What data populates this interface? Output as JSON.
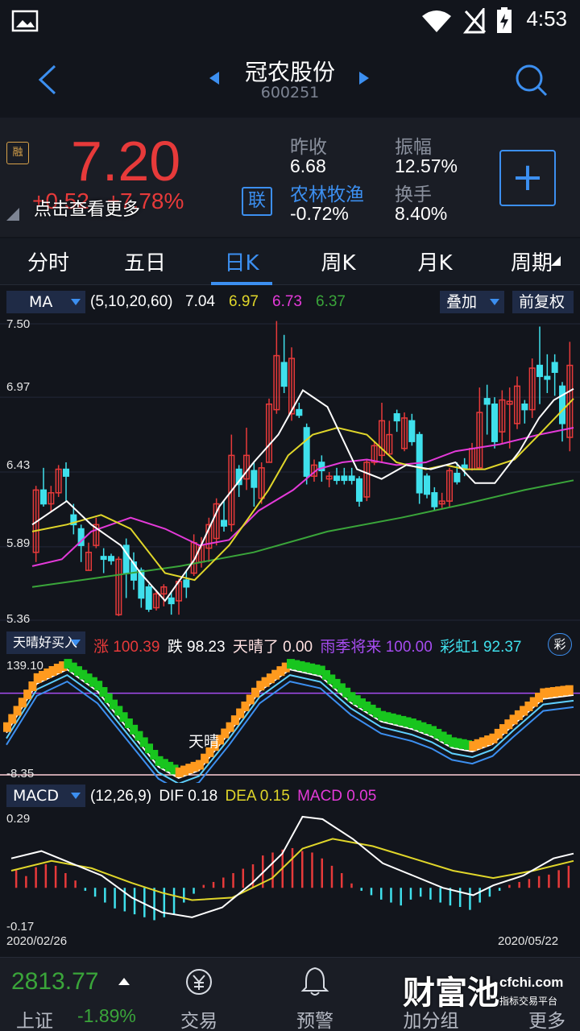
{
  "status_bar": {
    "time": "4:53"
  },
  "header": {
    "title": "冠农股份",
    "code": "600251"
  },
  "quote": {
    "price": "7.20",
    "change": "+0.52",
    "change_pct": "+7.78%",
    "tip": "点击查看更多",
    "badge": "融",
    "prev_close_label": "昨收",
    "prev_close": "6.68",
    "sector_name": "农林牧渔",
    "sector_change": "-0.72%",
    "amplitude_label": "振幅",
    "amplitude": "12.57%",
    "turnover_label": "换手",
    "turnover": "8.40%",
    "link_label": "联",
    "add_label": "+"
  },
  "tabs": [
    "分时",
    "五日",
    "日K",
    "周K",
    "月K",
    "周期"
  ],
  "active_tab": 2,
  "ma_bar": {
    "name": "MA",
    "params": "(5,10,20,60)",
    "ma5": "7.04",
    "ma10": "6.97",
    "ma20": "6.73",
    "ma60": "6.37",
    "overlay_label": "叠加",
    "adjust_label": "前复权"
  },
  "kline_axis": {
    "top": "7.50",
    "upper": "6.97",
    "mid": "6.43",
    "lower": "5.89",
    "bottom": "5.36"
  },
  "signal_bar": {
    "name": "天晴好买入",
    "zhang_label": "涨",
    "zhang_value": "100.39",
    "die_label": "跌",
    "die_value": "98.23",
    "tianqing_label": "天晴了",
    "tianqing_value": "0.00",
    "yuji_label": "雨季将来",
    "yuji_value": "100.00",
    "caihong_label": "彩虹1",
    "caihong_value": "92.37",
    "cai_icon": "彩"
  },
  "signal_axis": {
    "top": "139.10",
    "bottom": "-8.35",
    "annotation": "天晴"
  },
  "macd_bar": {
    "name": "MACD",
    "params": "(12,26,9)",
    "dif_label": "DIF",
    "dif": "0.18",
    "dea_label": "DEA",
    "dea": "0.15",
    "macd_label": "MACD",
    "macd": "0.05"
  },
  "macd_axis": {
    "top": "0.29",
    "bottom": "-0.17",
    "date_start": "2020/02/26",
    "date_end": "2020/05/22"
  },
  "bottom_bar": {
    "index_value": "2813.77",
    "index_name": "上证",
    "index_change": "-1.89%",
    "trade_label": "交易",
    "alert_label": "预警",
    "group_label": "加分组",
    "more_label": "更多",
    "watermark_main": "财富池",
    "watermark_site": "cfchi.com",
    "watermark_sub": "指标交易平台"
  },
  "colors": {
    "up": "#e73a3a",
    "down": "#3fe0ec",
    "accent": "#3c8ff0",
    "ma5": "#ffffff",
    "ma10": "#e0d62a",
    "ma20": "#e43ad9",
    "ma60": "#3aa53a",
    "macd_dea": "#e0d62a"
  },
  "chart_data": {
    "type": "candlestick",
    "ylim": [
      5.36,
      7.5
    ],
    "candles": [
      [
        5.85,
        6.3,
        6.33,
        5.78
      ],
      [
        6.3,
        6.2,
        6.46,
        6.18
      ],
      [
        6.2,
        6.28,
        6.33,
        6.14
      ],
      [
        6.28,
        6.45,
        6.48,
        6.25
      ],
      [
        6.45,
        6.4,
        6.5,
        6.22
      ],
      [
        6.12,
        6.05,
        6.2,
        5.98
      ],
      [
        6.02,
        5.9,
        6.05,
        5.78
      ],
      [
        5.72,
        5.85,
        5.92,
        5.72
      ],
      [
        5.9,
        6.05,
        6.1,
        5.88
      ],
      [
        5.82,
        5.8,
        5.88,
        5.7
      ],
      [
        5.82,
        5.79,
        5.84,
        5.76
      ],
      [
        5.4,
        5.8,
        5.82,
        5.39
      ],
      [
        5.9,
        5.7,
        5.95,
        5.52
      ],
      [
        5.78,
        5.65,
        5.85,
        5.58
      ],
      [
        5.72,
        5.52,
        5.74,
        5.45
      ],
      [
        5.6,
        5.44,
        5.62,
        5.42
      ],
      [
        5.45,
        5.55,
        5.58,
        5.43
      ],
      [
        5.55,
        5.6,
        5.62,
        5.46
      ],
      [
        5.52,
        5.48,
        5.56,
        5.4
      ],
      [
        5.5,
        5.64,
        5.66,
        5.4
      ],
      [
        5.65,
        5.6,
        5.72,
        5.52
      ],
      [
        5.7,
        5.92,
        5.98,
        5.68
      ],
      [
        5.78,
        5.9,
        5.96,
        5.74
      ],
      [
        5.88,
        6.05,
        6.1,
        5.78
      ],
      [
        5.95,
        6.2,
        6.24,
        5.9
      ],
      [
        6.08,
        6.04,
        6.22,
        6.0
      ],
      [
        6.05,
        6.55,
        6.7,
        6.0
      ],
      [
        6.45,
        6.34,
        6.48,
        6.25
      ],
      [
        6.38,
        6.55,
        6.75,
        6.3
      ],
      [
        6.44,
        6.32,
        6.5,
        6.18
      ],
      [
        6.24,
        6.46,
        6.5,
        6.2
      ],
      [
        6.5,
        6.92,
        6.96,
        6.5
      ],
      [
        6.88,
        7.27,
        7.52,
        6.85
      ],
      [
        7.22,
        7.05,
        7.42,
        7.0
      ],
      [
        6.85,
        7.25,
        7.33,
        6.8
      ],
      [
        6.88,
        6.84,
        6.93,
        6.82
      ],
      [
        6.75,
        6.4,
        6.78,
        6.34
      ],
      [
        6.4,
        6.48,
        6.52,
        6.36
      ],
      [
        6.5,
        6.44,
        6.55,
        6.36
      ],
      [
        6.38,
        6.4,
        6.43,
        6.32
      ],
      [
        6.4,
        6.37,
        6.46,
        6.34
      ],
      [
        6.4,
        6.37,
        6.46,
        6.34
      ],
      [
        6.4,
        6.37,
        6.46,
        6.34
      ],
      [
        6.38,
        6.22,
        6.4,
        6.18
      ],
      [
        6.25,
        6.5,
        6.52,
        6.22
      ],
      [
        6.5,
        6.62,
        6.65,
        6.48
      ],
      [
        6.55,
        6.8,
        6.93,
        6.5
      ],
      [
        6.56,
        6.7,
        6.8,
        6.56
      ],
      [
        6.85,
        6.8,
        6.88,
        6.72
      ],
      [
        6.6,
        6.82,
        6.86,
        6.58
      ],
      [
        6.8,
        6.65,
        6.85,
        6.62
      ],
      [
        6.7,
        6.28,
        6.72,
        6.2
      ],
      [
        6.4,
        6.27,
        6.42,
        6.24
      ],
      [
        6.28,
        6.18,
        6.32,
        6.15
      ],
      [
        6.2,
        6.22,
        6.28,
        6.17
      ],
      [
        6.22,
        6.44,
        6.46,
        6.18
      ],
      [
        6.42,
        6.36,
        6.5,
        6.34
      ],
      [
        6.48,
        6.45,
        6.53,
        6.4
      ],
      [
        6.45,
        6.6,
        6.64,
        6.44
      ],
      [
        6.46,
        6.86,
        7.04,
        6.46
      ],
      [
        6.96,
        6.92,
        7.06,
        6.7
      ],
      [
        6.92,
        6.65,
        6.97,
        6.6
      ],
      [
        6.72,
        6.95,
        7.02,
        6.64
      ],
      [
        6.92,
        6.94,
        7.04,
        6.6
      ],
      [
        6.78,
        7.05,
        7.12,
        6.74
      ],
      [
        6.92,
        6.88,
        6.95,
        6.78
      ],
      [
        6.88,
        7.18,
        7.25,
        6.82
      ],
      [
        7.2,
        7.12,
        7.48,
        6.92
      ],
      [
        7.12,
        7.1,
        7.28,
        7.0
      ],
      [
        7.22,
        7.15,
        7.28,
        6.98
      ],
      [
        7.05,
        6.78,
        7.08,
        6.65
      ],
      [
        6.68,
        7.2,
        7.37,
        6.58
      ]
    ],
    "ma5_points": [
      [
        0,
        6.05
      ],
      [
        7,
        6.22
      ],
      [
        12,
        6.05
      ],
      [
        18,
        5.9
      ],
      [
        22,
        5.7
      ],
      [
        27,
        5.5
      ],
      [
        33,
        5.8
      ],
      [
        38,
        6.18
      ],
      [
        45,
        6.5
      ],
      [
        50,
        6.7
      ],
      [
        55,
        7.02
      ],
      [
        60,
        6.9
      ],
      [
        66,
        6.45
      ],
      [
        71,
        6.38
      ],
      [
        76,
        6.48
      ],
      [
        81,
        6.45
      ],
      [
        86,
        6.5
      ],
      [
        90,
        6.35
      ],
      [
        94,
        6.35
      ],
      [
        99,
        6.58
      ],
      [
        103,
        6.82
      ],
      [
        106,
        6.95
      ],
      [
        110,
        7.03
      ]
    ],
    "ma10_points": [
      [
        0,
        6.0
      ],
      [
        7,
        6.05
      ],
      [
        14,
        6.12
      ],
      [
        20,
        6.02
      ],
      [
        27,
        5.7
      ],
      [
        33,
        5.65
      ],
      [
        40,
        5.9
      ],
      [
        48,
        6.3
      ],
      [
        52,
        6.55
      ],
      [
        57,
        6.7
      ],
      [
        62,
        6.75
      ],
      [
        68,
        6.7
      ],
      [
        74,
        6.5
      ],
      [
        80,
        6.45
      ],
      [
        84,
        6.48
      ],
      [
        88,
        6.45
      ],
      [
        92,
        6.45
      ],
      [
        98,
        6.52
      ],
      [
        103,
        6.7
      ],
      [
        110,
        6.96
      ]
    ],
    "ma20_points": [
      [
        0,
        5.75
      ],
      [
        6,
        5.8
      ],
      [
        12,
        6.0
      ],
      [
        20,
        6.1
      ],
      [
        27,
        6.02
      ],
      [
        34,
        5.9
      ],
      [
        40,
        5.94
      ],
      [
        46,
        6.15
      ],
      [
        53,
        6.3
      ],
      [
        58,
        6.45
      ],
      [
        63,
        6.5
      ],
      [
        68,
        6.52
      ],
      [
        74,
        6.48
      ],
      [
        80,
        6.5
      ],
      [
        86,
        6.58
      ],
      [
        95,
        6.63
      ],
      [
        103,
        6.7
      ],
      [
        110,
        6.75
      ]
    ],
    "ma60_points": [
      [
        0,
        5.6
      ],
      [
        14,
        5.67
      ],
      [
        30,
        5.75
      ],
      [
        45,
        5.85
      ],
      [
        60,
        6.0
      ],
      [
        75,
        6.1
      ],
      [
        88,
        6.2
      ],
      [
        100,
        6.3
      ],
      [
        110,
        6.37
      ]
    ],
    "macd_bars": [
      0.12,
      0.08,
      0.14,
      0.16,
      0.15,
      0.1,
      0.05,
      -0.02,
      -0.06,
      -0.1,
      -0.14,
      -0.16,
      -0.18,
      -0.2,
      -0.22,
      -0.2,
      -0.18,
      -0.1,
      -0.04,
      0.02,
      0.04,
      0.07,
      0.1,
      0.13,
      0.16,
      0.22,
      0.24,
      0.26,
      0.27,
      0.25,
      0.24,
      0.2,
      0.15,
      0.1,
      0.03,
      -0.02,
      -0.05,
      -0.08,
      -0.1,
      -0.12,
      -0.08,
      -0.06,
      -0.08,
      -0.1,
      -0.12,
      -0.13,
      -0.15,
      -0.1,
      -0.06,
      -0.02,
      0.02,
      0.04,
      0.06,
      0.08,
      0.09,
      0.12,
      0.15
    ],
    "dif_points": [
      [
        0,
        0.12
      ],
      [
        6,
        0.15
      ],
      [
        12,
        0.1
      ],
      [
        18,
        0.05
      ],
      [
        24,
        -0.04
      ],
      [
        30,
        -0.1
      ],
      [
        36,
        -0.12
      ],
      [
        42,
        -0.08
      ],
      [
        48,
        0.02
      ],
      [
        54,
        0.14
      ],
      [
        58,
        0.29
      ],
      [
        62,
        0.28
      ],
      [
        68,
        0.2
      ],
      [
        74,
        0.1
      ],
      [
        80,
        0.05
      ],
      [
        86,
        0.0
      ],
      [
        92,
        -0.03
      ],
      [
        96,
        0.01
      ],
      [
        102,
        0.05
      ],
      [
        108,
        0.12
      ],
      [
        112,
        0.14
      ]
    ],
    "dea_points": [
      [
        0,
        0.07
      ],
      [
        8,
        0.11
      ],
      [
        16,
        0.08
      ],
      [
        24,
        0.02
      ],
      [
        30,
        -0.02
      ],
      [
        36,
        -0.05
      ],
      [
        44,
        -0.04
      ],
      [
        52,
        0.04
      ],
      [
        58,
        0.16
      ],
      [
        64,
        0.2
      ],
      [
        72,
        0.17
      ],
      [
        80,
        0.12
      ],
      [
        88,
        0.07
      ],
      [
        96,
        0.04
      ],
      [
        104,
        0.07
      ],
      [
        112,
        0.11
      ]
    ],
    "signal_series": [
      [
        0,
        55
      ],
      [
        6,
        120
      ],
      [
        12,
        139
      ],
      [
        18,
        110
      ],
      [
        24,
        60
      ],
      [
        30,
        10
      ],
      [
        34,
        -5
      ],
      [
        38,
        5
      ],
      [
        44,
        55
      ],
      [
        50,
        110
      ],
      [
        56,
        139
      ],
      [
        62,
        130
      ],
      [
        68,
        95
      ],
      [
        74,
        70
      ],
      [
        80,
        60
      ],
      [
        84,
        50
      ],
      [
        88,
        35
      ],
      [
        92,
        30
      ],
      [
        96,
        40
      ],
      [
        100,
        65
      ],
      [
        106,
        100
      ],
      [
        112,
        105
      ]
    ],
    "purple_level": 100
  }
}
